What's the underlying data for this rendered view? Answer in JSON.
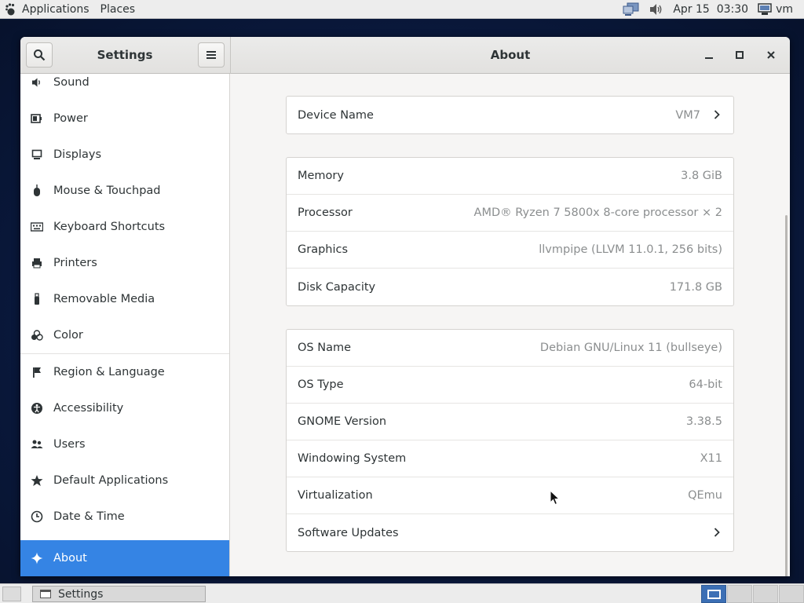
{
  "top_panel": {
    "applications": "Applications",
    "places": "Places",
    "date_time": "Apr 15  03:30",
    "user": "vm"
  },
  "window": {
    "sidebar_title": "Settings",
    "main_title": "About"
  },
  "sidebar": {
    "items": [
      {
        "label": "Sound",
        "icon": "speaker-icon"
      },
      {
        "label": "Power",
        "icon": "battery-icon"
      },
      {
        "label": "Displays",
        "icon": "display-icon"
      },
      {
        "label": "Mouse & Touchpad",
        "icon": "mouse-icon"
      },
      {
        "label": "Keyboard Shortcuts",
        "icon": "keyboard-icon"
      },
      {
        "label": "Printers",
        "icon": "printer-icon"
      },
      {
        "label": "Removable Media",
        "icon": "usb-icon"
      },
      {
        "label": "Color",
        "icon": "color-icon"
      },
      {
        "label": "Region & Language",
        "icon": "flag-icon"
      },
      {
        "label": "Accessibility",
        "icon": "accessibility-icon"
      },
      {
        "label": "Users",
        "icon": "users-icon"
      },
      {
        "label": "Default Applications",
        "icon": "star-icon"
      },
      {
        "label": "Date & Time",
        "icon": "clock-icon"
      },
      {
        "label": "About",
        "icon": "sparkle-icon"
      }
    ],
    "active": "About"
  },
  "about": {
    "device": {
      "label": "Device Name",
      "value": "VM7"
    },
    "hardware": [
      {
        "label": "Memory",
        "value": "3.8 GiB"
      },
      {
        "label": "Processor",
        "value": "AMD® Ryzen 7 5800x 8-core processor × 2"
      },
      {
        "label": "Graphics",
        "value": "llvmpipe (LLVM 11.0.1, 256 bits)"
      },
      {
        "label": "Disk Capacity",
        "value": "171.8 GB"
      }
    ],
    "software": [
      {
        "label": "OS Name",
        "value": "Debian GNU/Linux 11 (bullseye)"
      },
      {
        "label": "OS Type",
        "value": "64-bit"
      },
      {
        "label": "GNOME Version",
        "value": "3.38.5"
      },
      {
        "label": "Windowing System",
        "value": "X11"
      },
      {
        "label": "Virtualization",
        "value": "QEmu"
      },
      {
        "label": "Software Updates",
        "value": ""
      }
    ]
  },
  "taskbar": {
    "task_label": "Settings"
  },
  "colors": {
    "accent": "#3584e4",
    "panel": "#ededed",
    "desktop": "#0b1a3a"
  }
}
